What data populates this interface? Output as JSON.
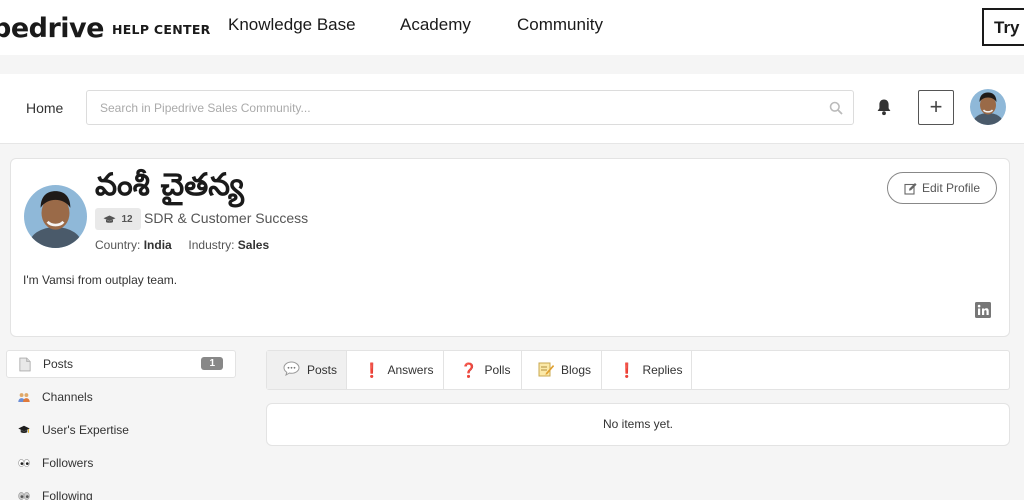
{
  "header": {
    "logo_text": "pedrive",
    "logo_sub": "HELP CENTER",
    "nav": [
      "Knowledge Base",
      "Academy",
      "Community"
    ],
    "try_label": "Try"
  },
  "community_bar": {
    "home_label": "Home",
    "search_placeholder": "Search in Pipedrive Sales Community..."
  },
  "profile": {
    "name": "వంశీ చైతన్య",
    "rank_count": "12",
    "rank_title": "SDR & Customer Success",
    "country_label": "Country:",
    "country": "India",
    "industry_label": "Industry:",
    "industry": "Sales",
    "bio": "I'm Vamsi from outplay team.",
    "edit_label": "Edit Profile"
  },
  "sidebar": {
    "items": [
      {
        "label": "Posts",
        "icon": "document-icon",
        "count": "1"
      },
      {
        "label": "Channels",
        "icon": "people-icon"
      },
      {
        "label": "User's Expertise",
        "icon": "graduation-cap-icon"
      },
      {
        "label": "Followers",
        "icon": "eyes-icon"
      },
      {
        "label": "Following",
        "icon": "eyes-icon"
      }
    ]
  },
  "tabs": [
    {
      "label": "Posts",
      "icon": "speech-bubble-icon"
    },
    {
      "label": "Answers",
      "icon": "exclamation-icon"
    },
    {
      "label": "Polls",
      "icon": "question-icon"
    },
    {
      "label": "Blogs",
      "icon": "memo-icon"
    },
    {
      "label": "Replies",
      "icon": "exclamation-icon"
    }
  ],
  "empty_message": "No items yet."
}
